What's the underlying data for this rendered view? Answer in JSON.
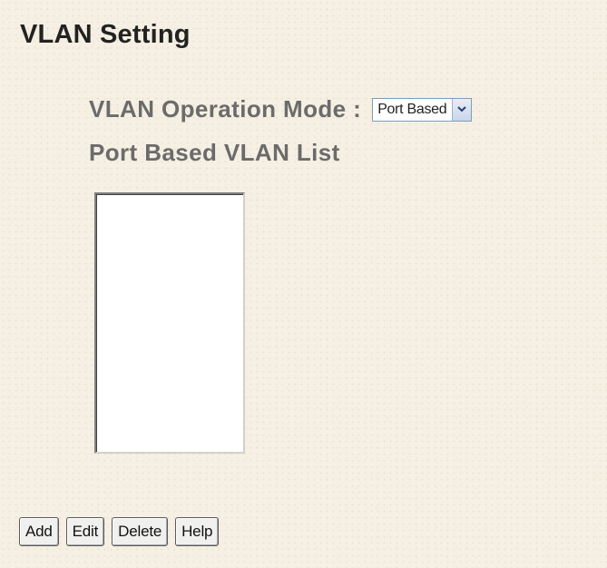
{
  "page": {
    "title": "VLAN Setting"
  },
  "mode": {
    "label": "VLAN Operation Mode :",
    "selected": "Port Based",
    "dropdown_icon": "chevron-down-icon"
  },
  "list": {
    "heading": "Port Based VLAN List",
    "items": []
  },
  "buttons": {
    "add": "Add",
    "edit": "Edit",
    "delete": "Delete",
    "help": "Help"
  }
}
